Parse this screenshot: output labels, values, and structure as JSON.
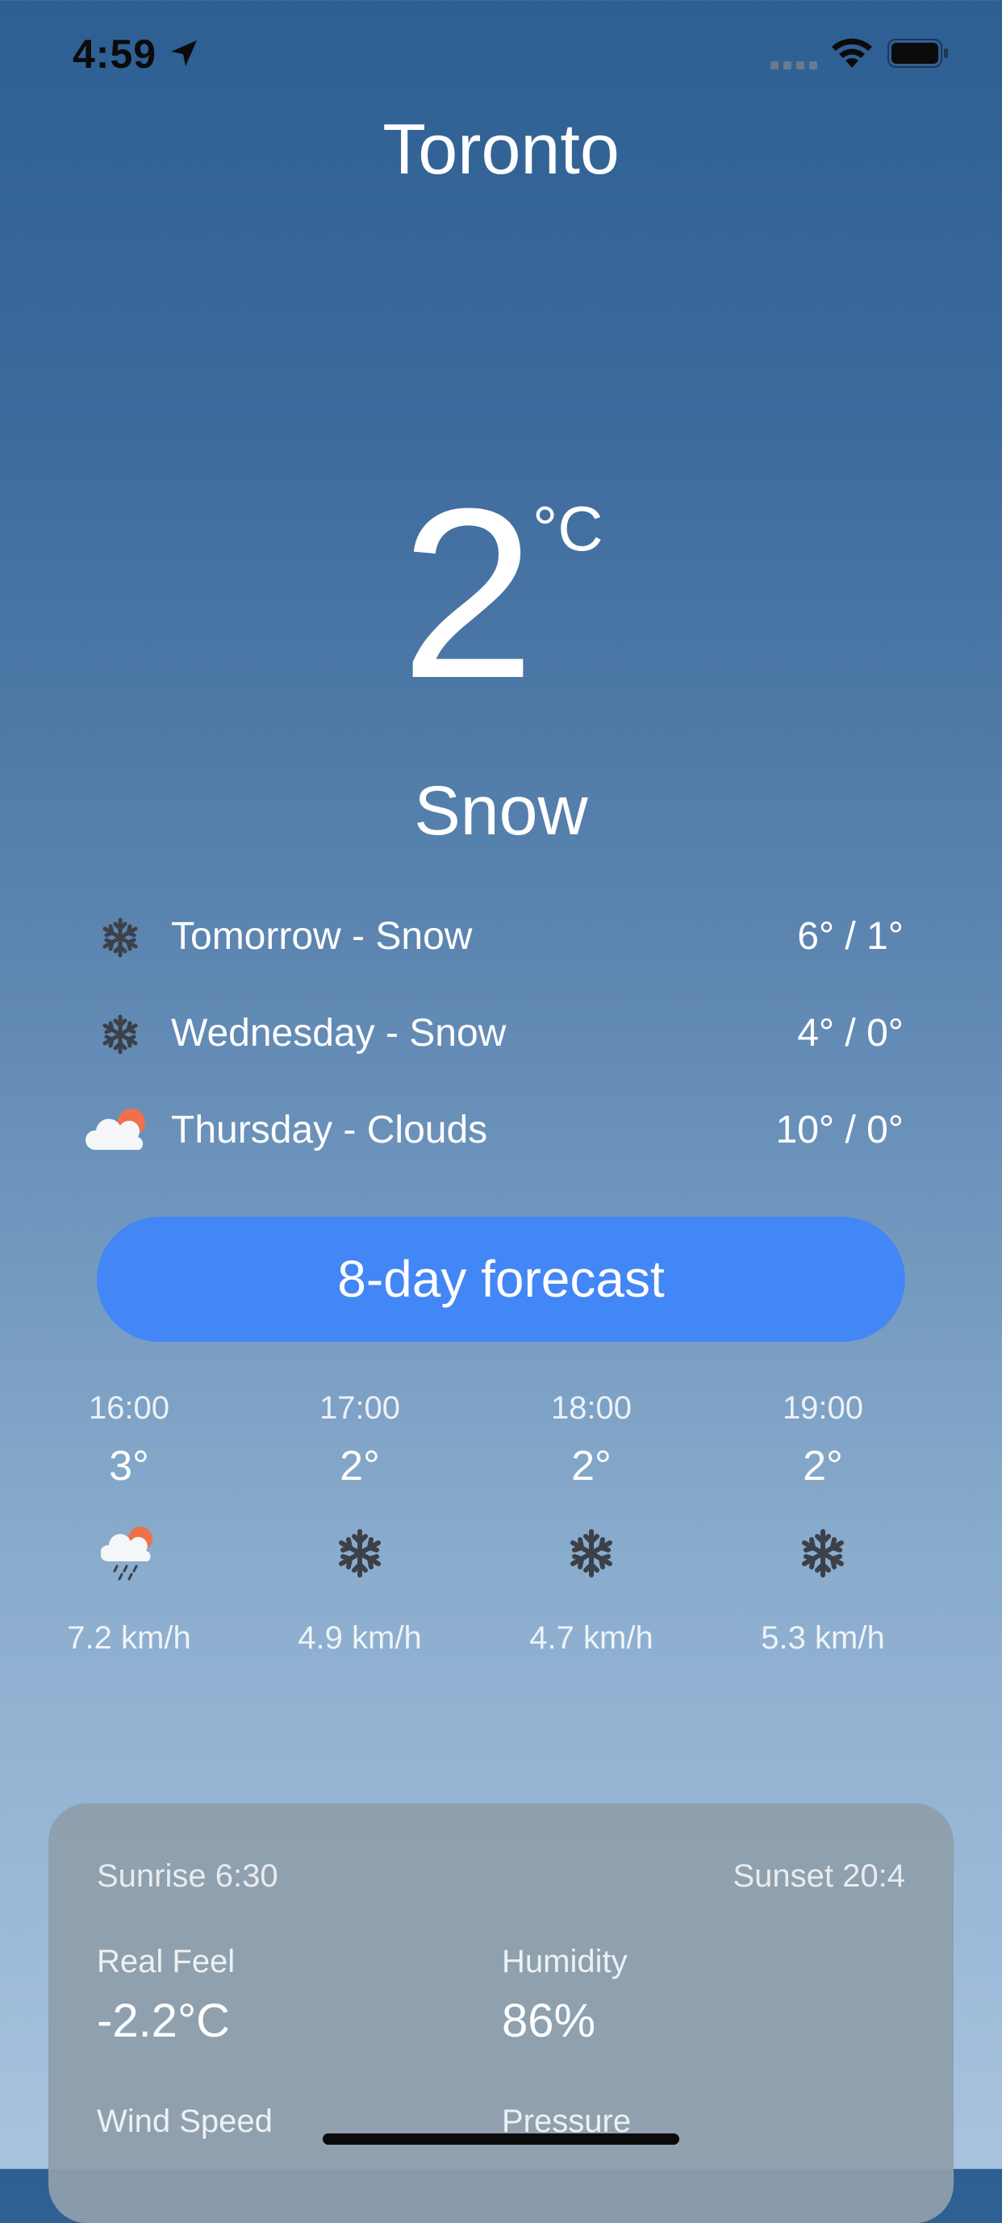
{
  "status_bar": {
    "time": "4:59"
  },
  "current": {
    "city": "Toronto",
    "temperature": "2",
    "unit": "°C",
    "condition": "Snow"
  },
  "daily": [
    {
      "icon": "snowflake-icon",
      "label": "Tomorrow - Snow",
      "temps": "6° / 1°"
    },
    {
      "icon": "snowflake-icon",
      "label": "Wednesday - Snow",
      "temps": "4° / 0°"
    },
    {
      "icon": "cloud-sun-icon",
      "label": "Thursday - Clouds",
      "temps": "10° / 0°"
    }
  ],
  "forecast_button": {
    "label": "8-day forecast"
  },
  "hourly": [
    {
      "time": "16:00",
      "temp": "3°",
      "icon": "cloud-rain-sun-icon",
      "wind": "7.2 km/h"
    },
    {
      "time": "17:00",
      "temp": "2°",
      "icon": "snowflake-icon",
      "wind": "4.9 km/h"
    },
    {
      "time": "18:00",
      "temp": "2°",
      "icon": "snowflake-icon",
      "wind": "4.7 km/h"
    },
    {
      "time": "19:00",
      "temp": "2°",
      "icon": "snowflake-icon",
      "wind": "5.3 km/h"
    }
  ],
  "details": {
    "sunrise": "Sunrise 6:30",
    "sunset": "Sunset 20:4",
    "real_feel_label": "Real Feel",
    "real_feel_value": "-2.2°C",
    "humidity_label": "Humidity",
    "humidity_value": "86%",
    "wind_speed_label": "Wind Speed",
    "pressure_label": "Pressure"
  },
  "colors": {
    "button": "#4386f5",
    "sun": "#f0704a",
    "icon_dark": "#3c4048"
  }
}
